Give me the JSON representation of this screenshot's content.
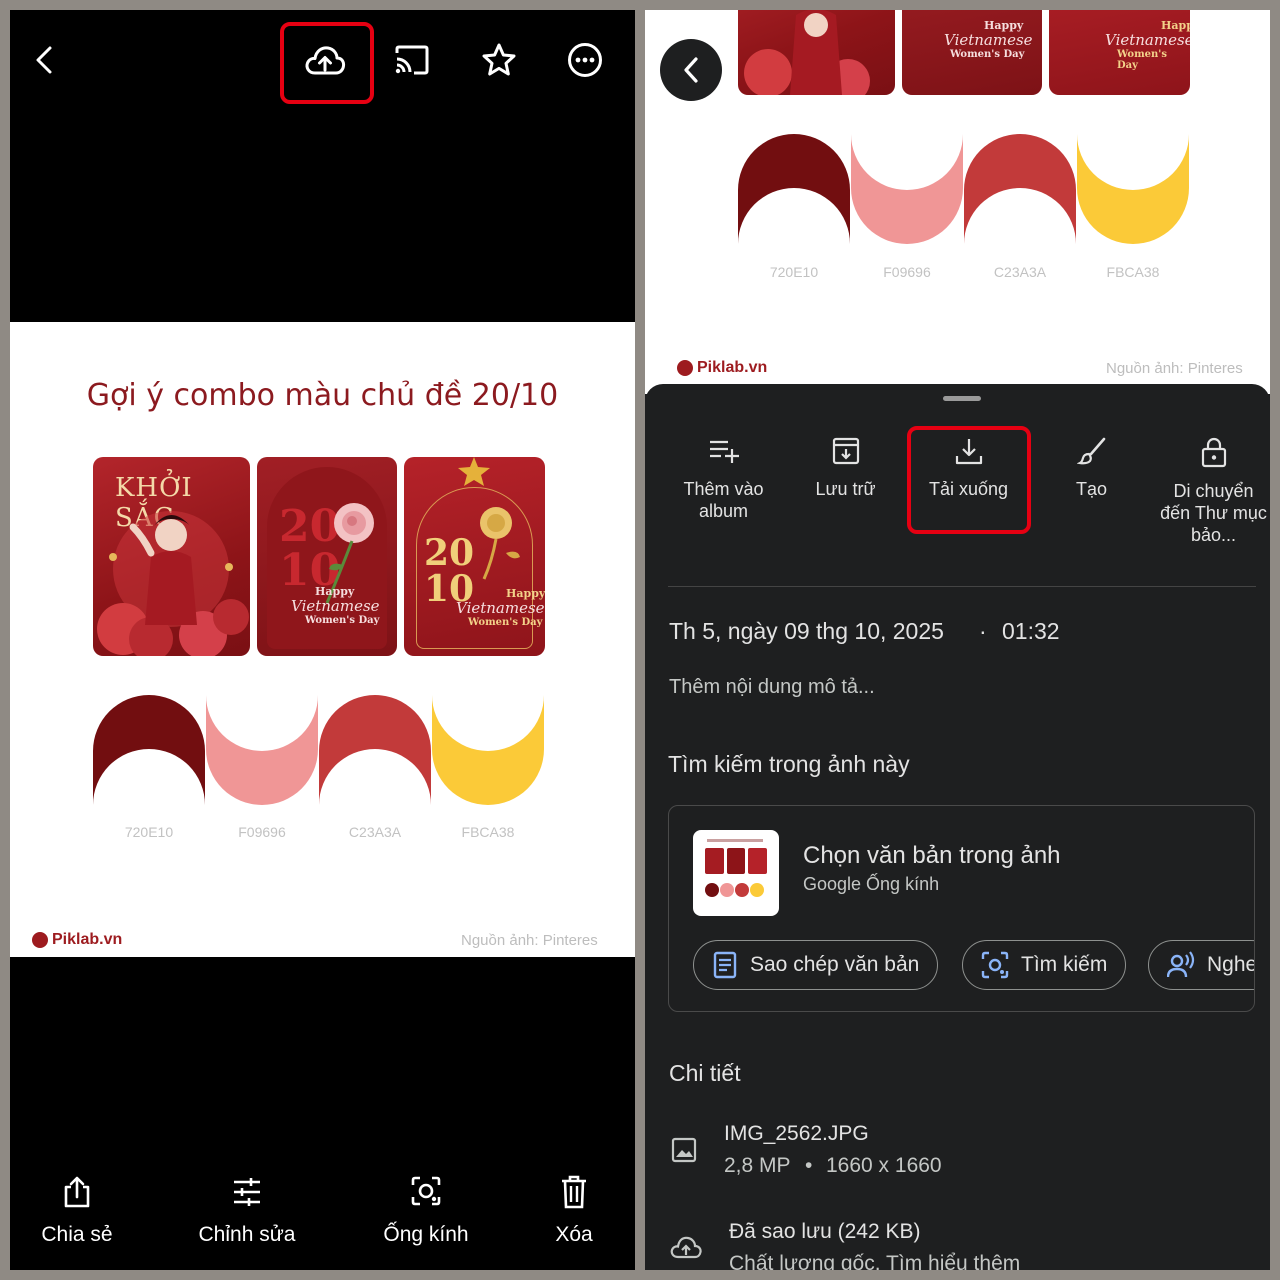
{
  "left": {
    "toolbar": {
      "back_icon": "chevron-left-icon",
      "upload_icon": "cloud-upload-icon",
      "cast_icon": "cast-icon",
      "star_icon": "star-icon",
      "more_icon": "more-horizontal-icon",
      "highlight_color": "#e60012"
    },
    "poster": {
      "title": "Gợi ý combo màu chủ đề 20/10",
      "card1_text": "KHỞI SẮC",
      "card2_big": "20 10",
      "card2_caption_top": "Happy",
      "card2_caption_script": "Vietnamese",
      "card2_caption_bottom": "Women's Day",
      "card3_big": "20 10",
      "card3_caption_top": "Happy",
      "card3_caption_script": "Vietnamese",
      "card3_caption_bottom": "Women's Day",
      "swatches": [
        {
          "hex": "#720E10",
          "label": "720E10"
        },
        {
          "hex": "#F09696",
          "label": "F09696"
        },
        {
          "hex": "#C23A3A",
          "label": "C23A3A"
        },
        {
          "hex": "#FBCA38",
          "label": "FBCA38"
        }
      ],
      "brand": "Piklab.vn",
      "source": "Nguồn ảnh: Pinteres"
    },
    "bottom_bar": [
      {
        "icon": "share-icon",
        "label": "Chia sẻ"
      },
      {
        "icon": "sliders-icon",
        "label": "Chỉnh sửa"
      },
      {
        "icon": "lens-icon",
        "label": "Ống kính"
      },
      {
        "icon": "trash-icon",
        "label": "Xóa"
      }
    ]
  },
  "right": {
    "back_icon": "chevron-left-icon",
    "preview": {
      "swatch_labels": [
        "720E10",
        "F09696",
        "C23A3A",
        "FBCA38"
      ],
      "brand": "Piklab.vn",
      "source": "Nguồn ảnh: Pinteres",
      "card_caption_top": "Happy",
      "card_caption_script": "Vietnamese",
      "card_caption_bottom": "Women's Day"
    },
    "actions": [
      {
        "icon": "playlist-add-icon",
        "label": "Thêm vào album"
      },
      {
        "icon": "archive-icon",
        "label": "Lưu trữ"
      },
      {
        "icon": "download-icon",
        "label": "Tải xuống"
      },
      {
        "icon": "brush-icon",
        "label": "Tạo"
      },
      {
        "icon": "lock-icon",
        "label": "Di chuyển đến Thư mục bảo..."
      }
    ],
    "date": "Th 5, ngày 09 thg 10, 2025",
    "time_separator": "·",
    "time": "01:32",
    "description_placeholder": "Thêm nội dung mô tả...",
    "search_heading": "Tìm kiếm trong ảnh này",
    "lens": {
      "title": "Chọn văn bản trong ảnh",
      "subtitle": "Google Ống kính",
      "chips": [
        {
          "icon": "copy-text-icon",
          "label": "Sao chép văn bản"
        },
        {
          "icon": "lens-search-icon",
          "label": "Tìm kiếm"
        },
        {
          "icon": "listen-icon",
          "label": "Nghe"
        }
      ]
    },
    "details_heading": "Chi tiết",
    "file": {
      "name": "IMG_2562.JPG",
      "megapixels": "2,8 MP",
      "separator": "•",
      "dimensions": "1660 x 1660"
    },
    "backup": {
      "title": "Đã sao lưu (242 KB)",
      "subtitle": "Chất lượng gốc. Tìm hiểu thêm"
    }
  }
}
